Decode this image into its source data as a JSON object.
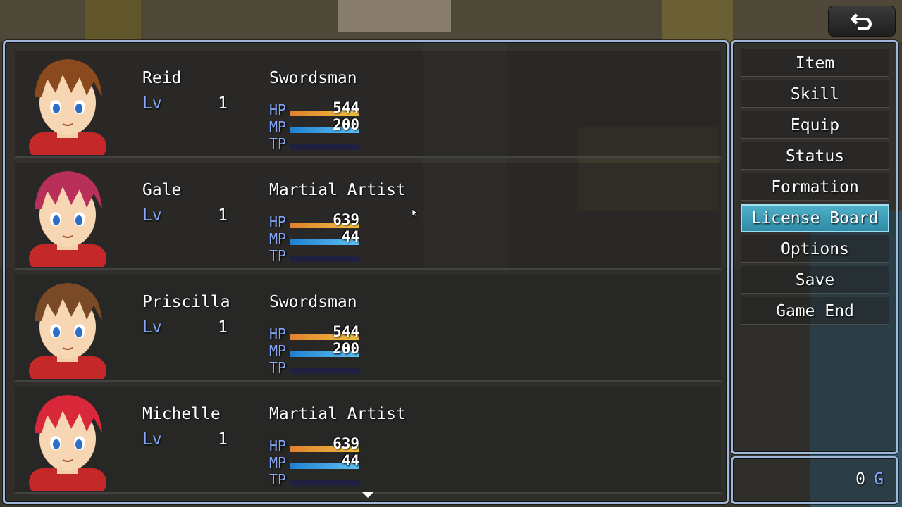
{
  "actors": [
    {
      "name": "Reid",
      "lv_label": "Lv",
      "level": "1",
      "class": "Swordsman",
      "hp_label": "HP",
      "hp": "544",
      "mp_label": "MP",
      "mp": "200",
      "tp_label": "TP",
      "tp": "",
      "hair_color": "#8a4a1e",
      "face_id": "reid-portrait"
    },
    {
      "name": "Gale",
      "lv_label": "Lv",
      "level": "1",
      "class": "Martial Artist",
      "hp_label": "HP",
      "hp": "639",
      "mp_label": "MP",
      "mp": "44",
      "tp_label": "TP",
      "tp": "",
      "hair_color": "#b8305a",
      "face_id": "gale-portrait"
    },
    {
      "name": "Priscilla",
      "lv_label": "Lv",
      "level": "1",
      "class": "Swordsman",
      "hp_label": "HP",
      "hp": "544",
      "mp_label": "MP",
      "mp": "200",
      "tp_label": "TP",
      "tp": "",
      "hair_color": "#7a4a26",
      "face_id": "priscilla-portrait"
    },
    {
      "name": "Michelle",
      "lv_label": "Lv",
      "level": "1",
      "class": "Martial Artist",
      "hp_label": "HP",
      "hp": "639",
      "mp_label": "MP",
      "mp": "44",
      "tp_label": "TP",
      "tp": "",
      "hair_color": "#d8283a",
      "face_id": "michelle-portrait"
    }
  ],
  "gauges": {
    "hp_fill_fraction": 1.0,
    "mp_fill_fraction": 1.0,
    "tp_fill_fraction": 0.0,
    "hp_colors": [
      "#e08030",
      "#f0c040"
    ],
    "mp_colors": [
      "#2080d0",
      "#60c0f0"
    ]
  },
  "commands": [
    {
      "label": "Item"
    },
    {
      "label": "Skill"
    },
    {
      "label": "Equip"
    },
    {
      "label": "Status"
    },
    {
      "label": "Formation"
    },
    {
      "label": "License Board",
      "selected": true
    },
    {
      "label": "Options"
    },
    {
      "label": "Save"
    },
    {
      "label": "Game End"
    }
  ],
  "gold": {
    "value": "0",
    "unit": "G"
  },
  "back_button": {
    "icon": "return-arrow-icon"
  },
  "colors": {
    "window_border": "#9fb7d8",
    "system_blue": "#84a9ff",
    "selected_command": "#3a9cb8"
  }
}
